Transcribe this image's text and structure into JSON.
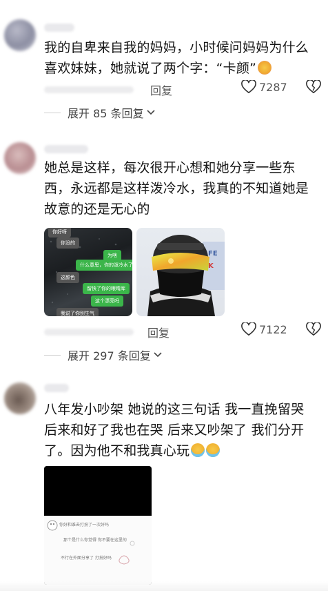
{
  "comments": [
    {
      "text": "我的自卑来自我的妈妈，小时候问妈妈为什么喜欢妹妹，她就说了两个字：“卡颜”",
      "emoji": "hugging-face-emoji",
      "reply_label": "回复",
      "likes": "7287",
      "expand_label": "展开 85 条回复"
    },
    {
      "text": "她总是这样，每次很开心想和她分享一些东西，永远都是这样泼冷水，我真的不知道她是故意的还是无心的",
      "reply_label": "回复",
      "likes": "7122",
      "expand_label": "展开 297 条回复",
      "chat_image": {
        "lines": [
          "你好呀",
          "你没的",
          "为啥",
          "什么意思，你的泼冷水了吧",
          "这颜色",
          "留快了你的眼睛库",
          "这个漂亮吗",
          "我说了你别生气"
        ]
      }
    },
    {
      "text": "八年发小吵架 她说的这三句话 我一直挽留哭 后来和好了我也在哭 后来又吵架了 我们分开了。因为他不和我真心玩",
      "emoji": "crying-face-emoji",
      "note_lines": [
        "你好和谁去打扮了一次好吗",
        "那个是什么你觉得 你不要在这里的",
        "不行在外面分享了 打扮好吗"
      ]
    }
  ],
  "colors": {
    "text": "#161616",
    "meta": "#555555",
    "accent_emoji": "#f7c948"
  }
}
